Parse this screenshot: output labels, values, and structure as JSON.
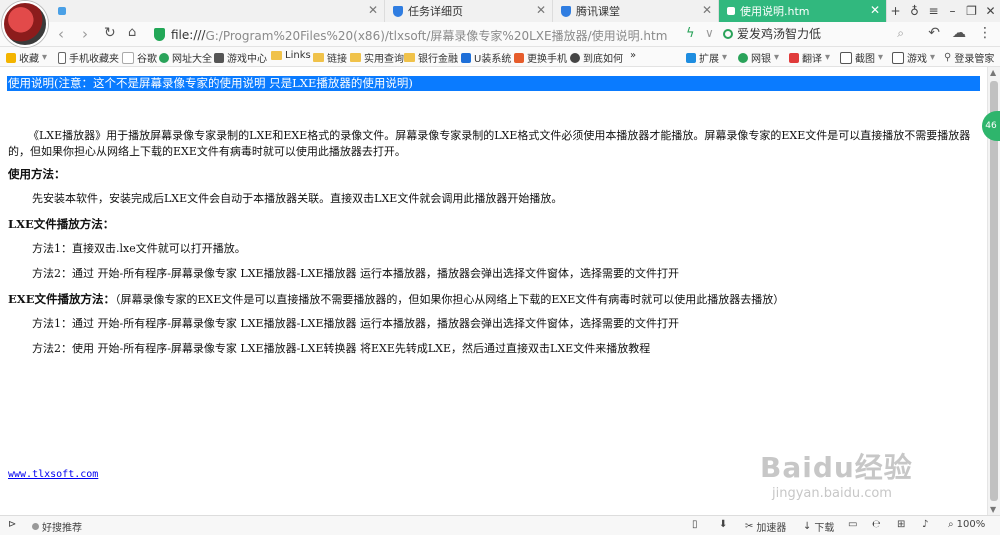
{
  "tabs": [
    {
      "title": "",
      "active": false
    },
    {
      "title": "任务详细页",
      "active": false
    },
    {
      "title": "腾讯课堂",
      "active": false
    },
    {
      "title": "使用说明.htm",
      "active": true
    }
  ],
  "address": {
    "scheme": "file:///",
    "path": "G:/Program%20Files%20(x86)/tlxsoft/屏幕录像专家%20LXE播放器/使用说明.htm",
    "search_value": "爱发鸡汤智力低"
  },
  "bookmarks": [
    "收藏",
    "手机收藏夹",
    "谷歌",
    "网址大全",
    "游戏中心",
    "Links",
    "链接",
    "实用查询",
    "银行金融",
    "U装系统",
    "更换手机",
    "到底如何"
  ],
  "bookmarks_more": "»",
  "toolbar_right": [
    "扩展",
    "网银",
    "翻译",
    "截图",
    "游戏",
    "登录管家"
  ],
  "doc": {
    "header": "使用说明(注意：这个不是屏幕录像专家的使用说明 只是LXE播放器的使用说明)",
    "intro": "《LXE播放器》用于播放屏幕录像专家录制的LXE和EXE格式的录像文件。屏幕录像专家录制的LXE格式文件必须使用本播放器才能播放。屏幕录像专家的EXE文件是可以直接播放不需要播放器的，但如果你担心从网络上下载的EXE文件有病毒时就可以使用此播放器去打开。",
    "usage_heading": "使用方法：",
    "usage_text": "先安装本软件，安装完成后LXE文件会自动于本播放器关联。直接双击LXE文件就会调用此播放器开始播放。",
    "lxe_heading": "LXE文件播放方法：",
    "lxe_method1": "方法1：直接双击.lxe文件就可以打开播放。",
    "lxe_method2": "方法2：通过 开始-所有程序-屏幕录像专家 LXE播放器-LXE播放器 运行本播放器，播放器会弹出选择文件窗体，选择需要的文件打开",
    "exe_heading": "EXE文件播放方法：",
    "exe_note": "（屏幕录像专家的EXE文件是可以直接播放不需要播放器的，但如果你担心从网络上下载的EXE文件有病毒时就可以使用此播放器去播放）",
    "exe_method1": "方法1：通过 开始-所有程序-屏幕录像专家 LXE播放器-LXE播放器 运行本播放器，播放器会弹出选择文件窗体，选择需要的文件打开",
    "exe_method2": "方法2：使用 开始-所有程序-屏幕录像专家 LXE播放器-LXE转换器 将EXE先转成LXE，然后通过直接双击LXE文件来播放教程",
    "link": "www.tlxsoft.com"
  },
  "watermark": {
    "brand": "Baidu经验",
    "url": "jingyan.baidu.com"
  },
  "side_badge": "46",
  "status": {
    "recommend": "好搜推荐",
    "accelerator": "加速器",
    "download": "下载",
    "zoom": "100%"
  }
}
